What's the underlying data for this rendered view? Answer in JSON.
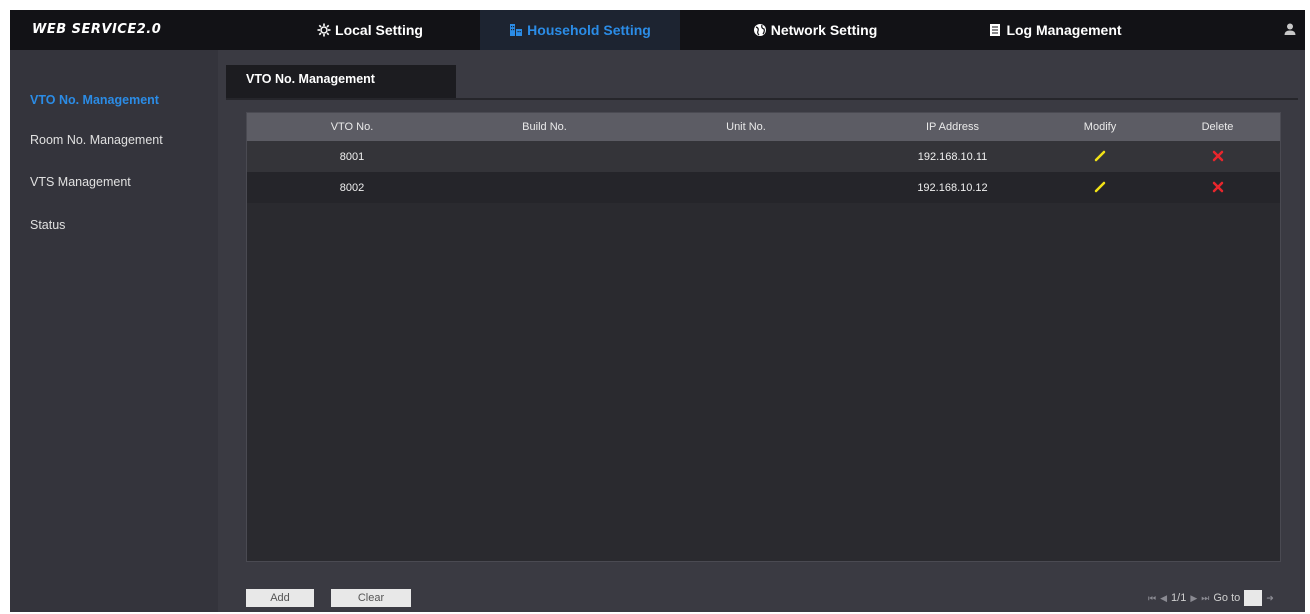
{
  "header": {
    "brand": "WEB SERVICE2.0",
    "tabs": [
      {
        "label": "Local Setting",
        "icon": "gear-icon"
      },
      {
        "label": "Household Setting",
        "icon": "building-icon"
      },
      {
        "label": "Network Setting",
        "icon": "globe-icon"
      },
      {
        "label": "Log Management",
        "icon": "document-icon"
      }
    ],
    "active_tab": "Household Setting",
    "user_icon": "user-icon"
  },
  "sidebar": {
    "items": [
      {
        "label": "VTO No. Management",
        "active": true
      },
      {
        "label": "Room No. Management",
        "active": false
      },
      {
        "label": "VTS Management",
        "active": false
      },
      {
        "label": "Status",
        "active": false
      }
    ]
  },
  "content": {
    "tab_label": "VTO No. Management",
    "table": {
      "columns": [
        "VTO No.",
        "Build No.",
        "Unit No.",
        "IP Address",
        "Modify",
        "Delete"
      ],
      "rows": [
        {
          "vto_no": "8001",
          "build_no": "",
          "unit_no": "",
          "ip_address": "192.168.10.11",
          "modify_icon": "pencil-icon",
          "delete_icon": "x-icon"
        },
        {
          "vto_no": "8002",
          "build_no": "",
          "unit_no": "",
          "ip_address": "192.168.10.12",
          "modify_icon": "pencil-icon",
          "delete_icon": "x-icon"
        }
      ]
    },
    "buttons": {
      "add_label": "Add",
      "clear_label": "Clear"
    },
    "pagination": {
      "page_text": "1/1",
      "goto_label": "Go to",
      "goto_value": ""
    }
  },
  "colors": {
    "accent": "#2b8ce6",
    "edit_icon": "#f2e216",
    "delete_icon": "#e8262c",
    "topbar_bg": "#121216",
    "content_bg": "#3a3a42"
  }
}
